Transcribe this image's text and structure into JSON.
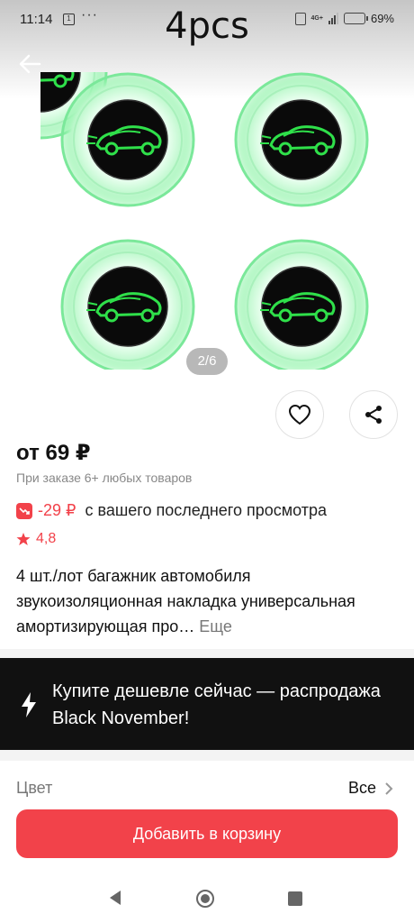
{
  "status_bar": {
    "time": "11:14",
    "notif_badge": "1",
    "dots": "···",
    "network": "4G+",
    "battery_text": "69%",
    "battery_level": 0.69
  },
  "gallery": {
    "overlay_title": "4pcs",
    "page_indicator": "2/6",
    "image_subject": "four round car door shock absorber pads with green glowing sports-car logo",
    "accent_glow": "#7cf29a"
  },
  "product": {
    "price": "от 69 ₽",
    "price_note": "При заказе 6+ любых товаров",
    "price_drop_value": "-29 ₽",
    "price_drop_text": "с вашего последнего просмотра",
    "rating": "4,8",
    "description": "4 шт./лот багажник автомобиля звукоизоляционная накладка универсальная амортизирующая про…",
    "more_link": "Еще"
  },
  "promo": {
    "text": "Купите дешевле сейчас — распродажа Black November!",
    "icon": "lightning-icon"
  },
  "options": {
    "color_label": "Цвет",
    "color_value": "Все"
  },
  "actions": {
    "add_to_cart": "Добавить в корзину"
  },
  "colors": {
    "accent": "#f2424a",
    "promo_bg": "#111111",
    "muted_text": "#888888"
  }
}
